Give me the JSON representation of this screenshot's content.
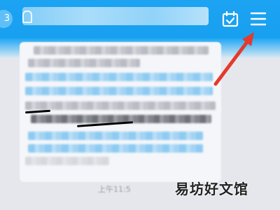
{
  "header": {
    "unread_count": "3",
    "calendar_icon": "calendar-check-icon",
    "menu_icon": "hamburger-menu-icon",
    "background": "#1ca3f2"
  },
  "message": {
    "time": "上午11:5"
  },
  "annotation": {
    "arrow_color": "#e33a2c",
    "target": "hamburger-menu-icon"
  },
  "watermark": {
    "text": "易坊好文馆"
  }
}
